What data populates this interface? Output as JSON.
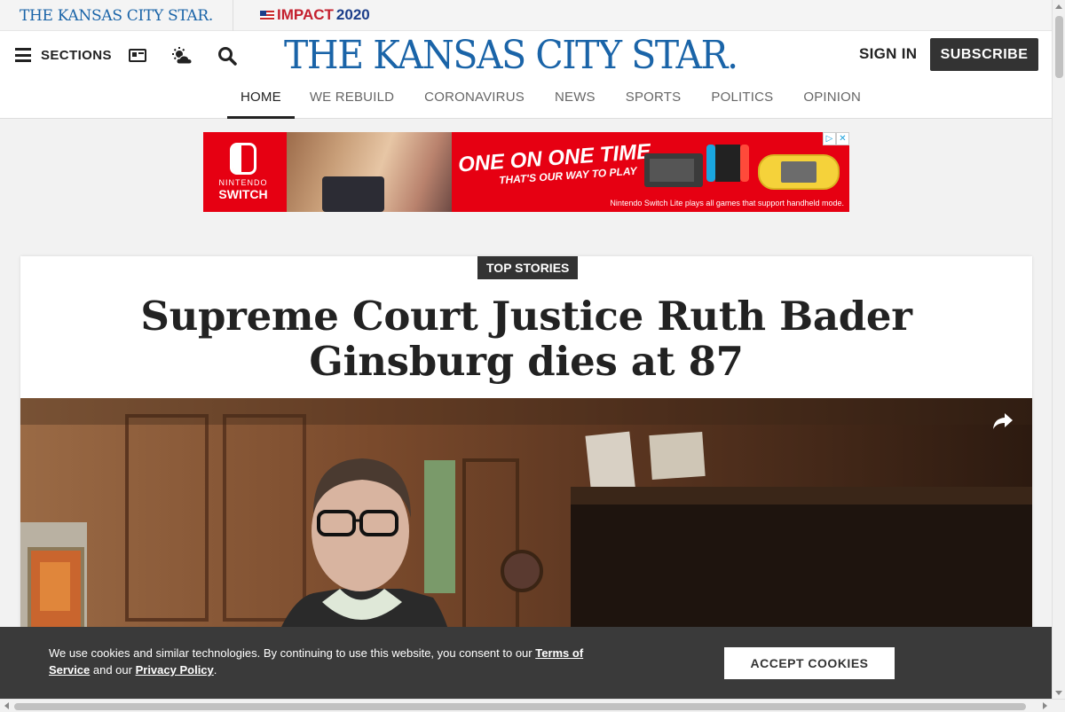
{
  "top_strip": {
    "brand_text": "THE KANSAS CITY STAR.",
    "impact_text": "IMPACT",
    "impact_year": "2020"
  },
  "header": {
    "sections_label": "SECTIONS",
    "logo_text": "THE KANSAS CITY STAR.",
    "sign_in_label": "SIGN IN",
    "subscribe_label": "SUBSCRIBE"
  },
  "nav": {
    "items": [
      {
        "label": "HOME",
        "active": true
      },
      {
        "label": "WE REBUILD"
      },
      {
        "label": "CORONAVIRUS"
      },
      {
        "label": "NEWS"
      },
      {
        "label": "SPORTS"
      },
      {
        "label": "POLITICS"
      },
      {
        "label": "OPINION"
      }
    ]
  },
  "ad": {
    "brand_line1": "NINTENDO",
    "brand_line2": "SWITCH",
    "headline": "ONE ON ONE TIME",
    "subheadline": "THAT'S OUR WAY TO PLAY",
    "fine_print": "Nintendo Switch Lite plays all games that support handheld mode."
  },
  "article": {
    "badge": "TOP STORIES",
    "headline": "Supreme Court Justice Ruth Bader Ginsburg dies at 87"
  },
  "cookie": {
    "text_before": "We use cookies and similar technologies. By continuing to use this website, you consent to our ",
    "terms_link": "Terms of Service",
    "text_middle": " and our ",
    "privacy_link": "Privacy Policy",
    "text_after": ".",
    "accept_label": "ACCEPT COOKIES"
  },
  "colors": {
    "brand_blue": "#1a64a8",
    "ad_red": "#e60012",
    "dark_button": "#333333"
  }
}
